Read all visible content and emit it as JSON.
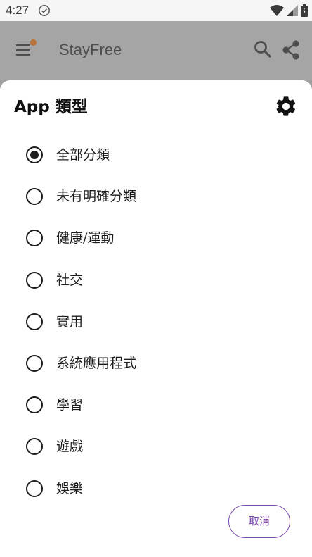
{
  "status_bar": {
    "time": "4:27",
    "icons": [
      "check-circle-icon",
      "wifi-icon",
      "signal-icon",
      "battery-icon"
    ]
  },
  "app_bar": {
    "title": "StayFree",
    "icons": [
      "menu-icon",
      "search-icon",
      "share-icon"
    ],
    "notification_dot_color": "#b9733a"
  },
  "sheet": {
    "title": "App 類型",
    "settings_icon": "gear-icon",
    "options": [
      {
        "label": "全部分類",
        "selected": true
      },
      {
        "label": "未有明確分類",
        "selected": false
      },
      {
        "label": "健康/運動",
        "selected": false
      },
      {
        "label": "社交",
        "selected": false
      },
      {
        "label": "實用",
        "selected": false
      },
      {
        "label": "系統應用程式",
        "selected": false
      },
      {
        "label": "學習",
        "selected": false
      },
      {
        "label": "遊戲",
        "selected": false
      },
      {
        "label": "娛樂",
        "selected": false
      }
    ],
    "cancel_label": "取消"
  },
  "colors": {
    "accent": "#7b4bab",
    "scrim": "#9e9e9e"
  }
}
